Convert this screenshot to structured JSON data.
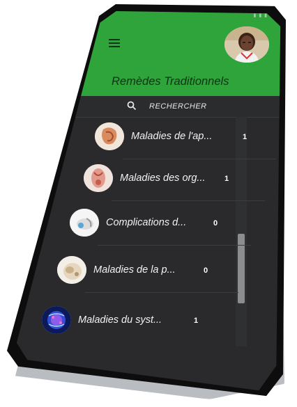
{
  "app": {
    "title": "Remèdes Traditionnels",
    "search_label": "RECHERCHER",
    "status_text": "▮ ▮ ▮"
  },
  "colors": {
    "appbar": "#2fa43a",
    "list_background": "#2a2a2c"
  },
  "icons": {
    "menu": "hamburger-menu-icon",
    "search": "search-icon"
  },
  "categories": [
    {
      "label": "Maladies de l'ap...",
      "count": "1"
    },
    {
      "label": "Maladies des org...",
      "count": "1"
    },
    {
      "label": "Complications d...",
      "count": "0"
    },
    {
      "label": "Maladies de la p...",
      "count": "0"
    },
    {
      "label": "Maladies du syst...",
      "count": "1"
    }
  ]
}
